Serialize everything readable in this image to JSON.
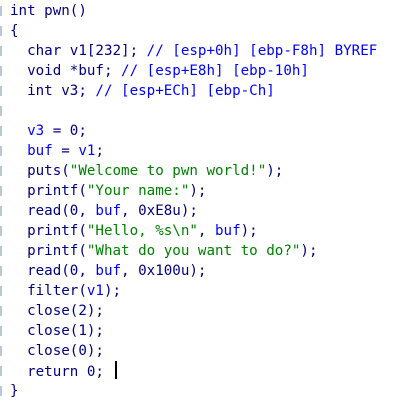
{
  "editor": {
    "lines": [
      [
        {
          "t": "int pwn()",
          "c": "plain"
        }
      ],
      [
        {
          "t": "{",
          "c": "plain"
        }
      ],
      [
        {
          "t": "  char v1[232]; ",
          "c": "plain"
        },
        {
          "t": "// [esp+0h] [ebp-F8h] BYREF",
          "c": "cm"
        }
      ],
      [
        {
          "t": "  void *buf; ",
          "c": "plain"
        },
        {
          "t": "// [esp+E8h] [ebp-10h]",
          "c": "cm"
        }
      ],
      [
        {
          "t": "  int v3; ",
          "c": "plain"
        },
        {
          "t": "// [esp+ECh] [ebp-Ch]",
          "c": "cm"
        }
      ],
      [
        {
          "t": "",
          "c": "plain"
        }
      ],
      [
        {
          "t": "  ",
          "c": "plain"
        },
        {
          "t": "v3",
          "c": "var"
        },
        {
          "t": " = 0;",
          "c": "plain"
        }
      ],
      [
        {
          "t": "  ",
          "c": "plain"
        },
        {
          "t": "buf",
          "c": "var"
        },
        {
          "t": " = ",
          "c": "plain"
        },
        {
          "t": "v1",
          "c": "var"
        },
        {
          "t": ";",
          "c": "plain"
        }
      ],
      [
        {
          "t": "  puts(",
          "c": "plain"
        },
        {
          "t": "\"Welcome to pwn world!\"",
          "c": "str"
        },
        {
          "t": ");",
          "c": "plain"
        }
      ],
      [
        {
          "t": "  printf(",
          "c": "plain"
        },
        {
          "t": "\"Your name:\"",
          "c": "str"
        },
        {
          "t": ");",
          "c": "plain"
        }
      ],
      [
        {
          "t": "  read(0, ",
          "c": "plain"
        },
        {
          "t": "buf",
          "c": "var"
        },
        {
          "t": ", 0xE8u);",
          "c": "plain"
        }
      ],
      [
        {
          "t": "  printf(",
          "c": "plain"
        },
        {
          "t": "\"Hello, %s\\n\"",
          "c": "str"
        },
        {
          "t": ", ",
          "c": "plain"
        },
        {
          "t": "buf",
          "c": "var"
        },
        {
          "t": ");",
          "c": "plain"
        }
      ],
      [
        {
          "t": "  printf(",
          "c": "plain"
        },
        {
          "t": "\"What do you want to do?\"",
          "c": "str"
        },
        {
          "t": ");",
          "c": "plain"
        }
      ],
      [
        {
          "t": "  read(0, ",
          "c": "plain"
        },
        {
          "t": "buf",
          "c": "var"
        },
        {
          "t": ", 0x100u);",
          "c": "plain"
        }
      ],
      [
        {
          "t": "  filter(",
          "c": "plain"
        },
        {
          "t": "v1",
          "c": "var"
        },
        {
          "t": ");",
          "c": "plain"
        }
      ],
      [
        {
          "t": "  close(2);",
          "c": "plain"
        }
      ],
      [
        {
          "t": "  close(1);",
          "c": "plain"
        }
      ],
      [
        {
          "t": "  close(0);",
          "c": "plain"
        }
      ],
      [
        {
          "t": "  return 0; ",
          "c": "plain"
        }
      ],
      [
        {
          "t": "}",
          "c": "plain"
        }
      ]
    ],
    "caret_line": 18,
    "colors": {
      "text": "#000080",
      "comment": "#0000ff",
      "string": "#008000",
      "variable": "#0000ff",
      "background": "#ffffff",
      "gutter_mark": "#b9c7d6"
    }
  }
}
